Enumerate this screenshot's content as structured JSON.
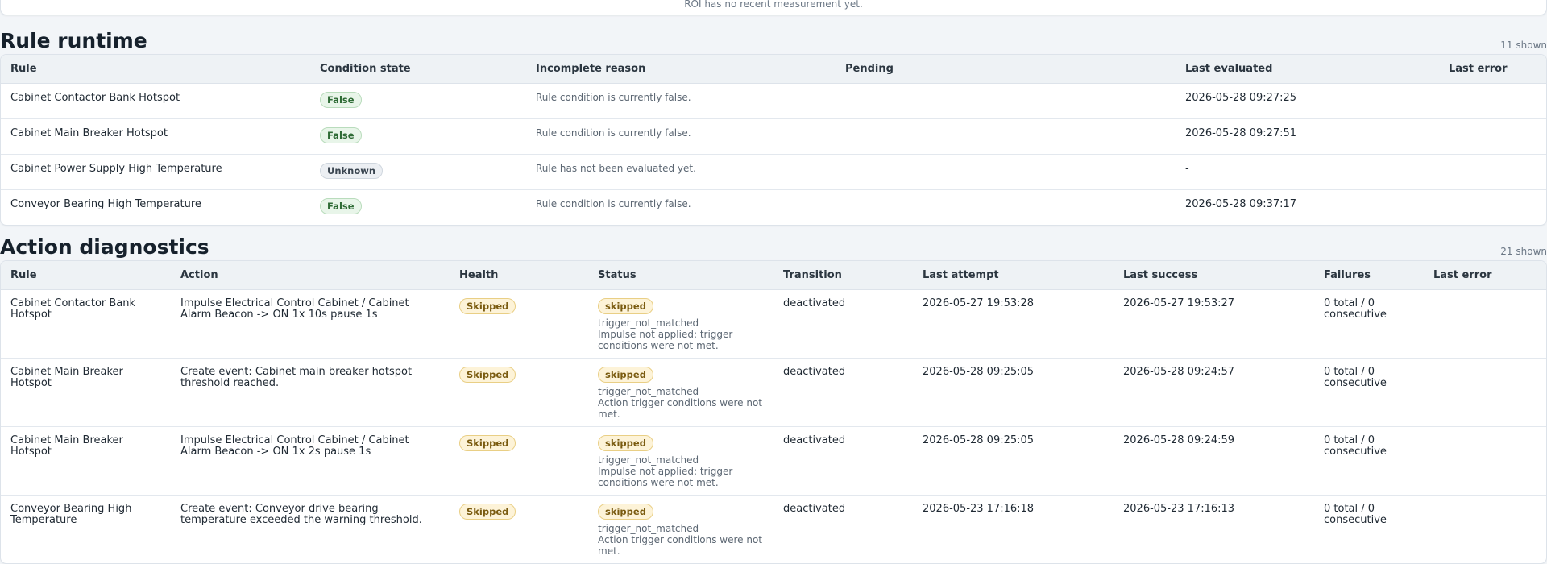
{
  "top_card": {
    "message": "ROI has no recent measurement yet."
  },
  "rule_runtime": {
    "title": "Rule runtime",
    "shown": "11 shown",
    "headers": [
      "Rule",
      "Condition state",
      "Incomplete reason",
      "Pending",
      "Last evaluated",
      "Last error"
    ],
    "rows": [
      {
        "rule": "Cabinet Contactor Bank Hotspot",
        "state": "False",
        "reason": "Rule condition is currently false.",
        "pending": "",
        "last_evaluated": "2026-05-28 09:27:25",
        "last_error": ""
      },
      {
        "rule": "Cabinet Main Breaker Hotspot",
        "state": "False",
        "reason": "Rule condition is currently false.",
        "pending": "",
        "last_evaluated": "2026-05-28 09:27:51",
        "last_error": ""
      },
      {
        "rule": "Cabinet Power Supply High Temperature",
        "state": "Unknown",
        "reason": "Rule has not been evaluated yet.",
        "pending": "",
        "last_evaluated": "-",
        "last_error": ""
      },
      {
        "rule": "Conveyor Bearing High Temperature",
        "state": "False",
        "reason": "Rule condition is currently false.",
        "pending": "",
        "last_evaluated": "2026-05-28 09:37:17",
        "last_error": ""
      }
    ]
  },
  "action_diagnostics": {
    "title": "Action diagnostics",
    "shown": "21 shown",
    "headers": [
      "Rule",
      "Action",
      "Health",
      "Status",
      "Transition",
      "Last attempt",
      "Last success",
      "Failures",
      "Last error"
    ],
    "rows": [
      {
        "rule": "Cabinet Contactor Bank Hotspot",
        "action": "Impulse Electrical Control Cabinet / Cabinet Alarm Beacon -> ON 1x 10s pause 1s",
        "health": "Skipped",
        "status": "skipped",
        "status_code": "trigger_not_matched",
        "status_detail": "Impulse not applied: trigger conditions were not met.",
        "transition": "deactivated",
        "last_attempt": "2026-05-27 19:53:28",
        "last_success": "2026-05-27 19:53:27",
        "failures": "0 total / 0 consecutive",
        "last_error": ""
      },
      {
        "rule": "Cabinet Main Breaker Hotspot",
        "action": "Create event: Cabinet main breaker hotspot threshold reached.",
        "health": "Skipped",
        "status": "skipped",
        "status_code": "trigger_not_matched",
        "status_detail": "Action trigger conditions were not met.",
        "transition": "deactivated",
        "last_attempt": "2026-05-28 09:25:05",
        "last_success": "2026-05-28 09:24:57",
        "failures": "0 total / 0 consecutive",
        "last_error": ""
      },
      {
        "rule": "Cabinet Main Breaker Hotspot",
        "action": "Impulse Electrical Control Cabinet / Cabinet Alarm Beacon -> ON 1x 2s pause 1s",
        "health": "Skipped",
        "status": "skipped",
        "status_code": "trigger_not_matched",
        "status_detail": "Impulse not applied: trigger conditions were not met.",
        "transition": "deactivated",
        "last_attempt": "2026-05-28 09:25:05",
        "last_success": "2026-05-28 09:24:59",
        "failures": "0 total / 0 consecutive",
        "last_error": ""
      },
      {
        "rule": "Conveyor Bearing High Temperature",
        "action": "Create event: Conveyor drive bearing temperature exceeded the warning threshold.",
        "health": "Skipped",
        "status": "skipped",
        "status_code": "trigger_not_matched",
        "status_detail": "Action trigger conditions were not met.",
        "transition": "deactivated",
        "last_attempt": "2026-05-23 17:16:18",
        "last_success": "2026-05-23 17:16:13",
        "failures": "0 total / 0 consecutive",
        "last_error": ""
      }
    ]
  },
  "colors": {
    "page_bg": "#f2f5f8",
    "header_bg": "#eef2f5",
    "false_badge": "#e8f5e9",
    "unknown_badge": "#eceff3",
    "skipped_badge": "#fdf3d8"
  }
}
